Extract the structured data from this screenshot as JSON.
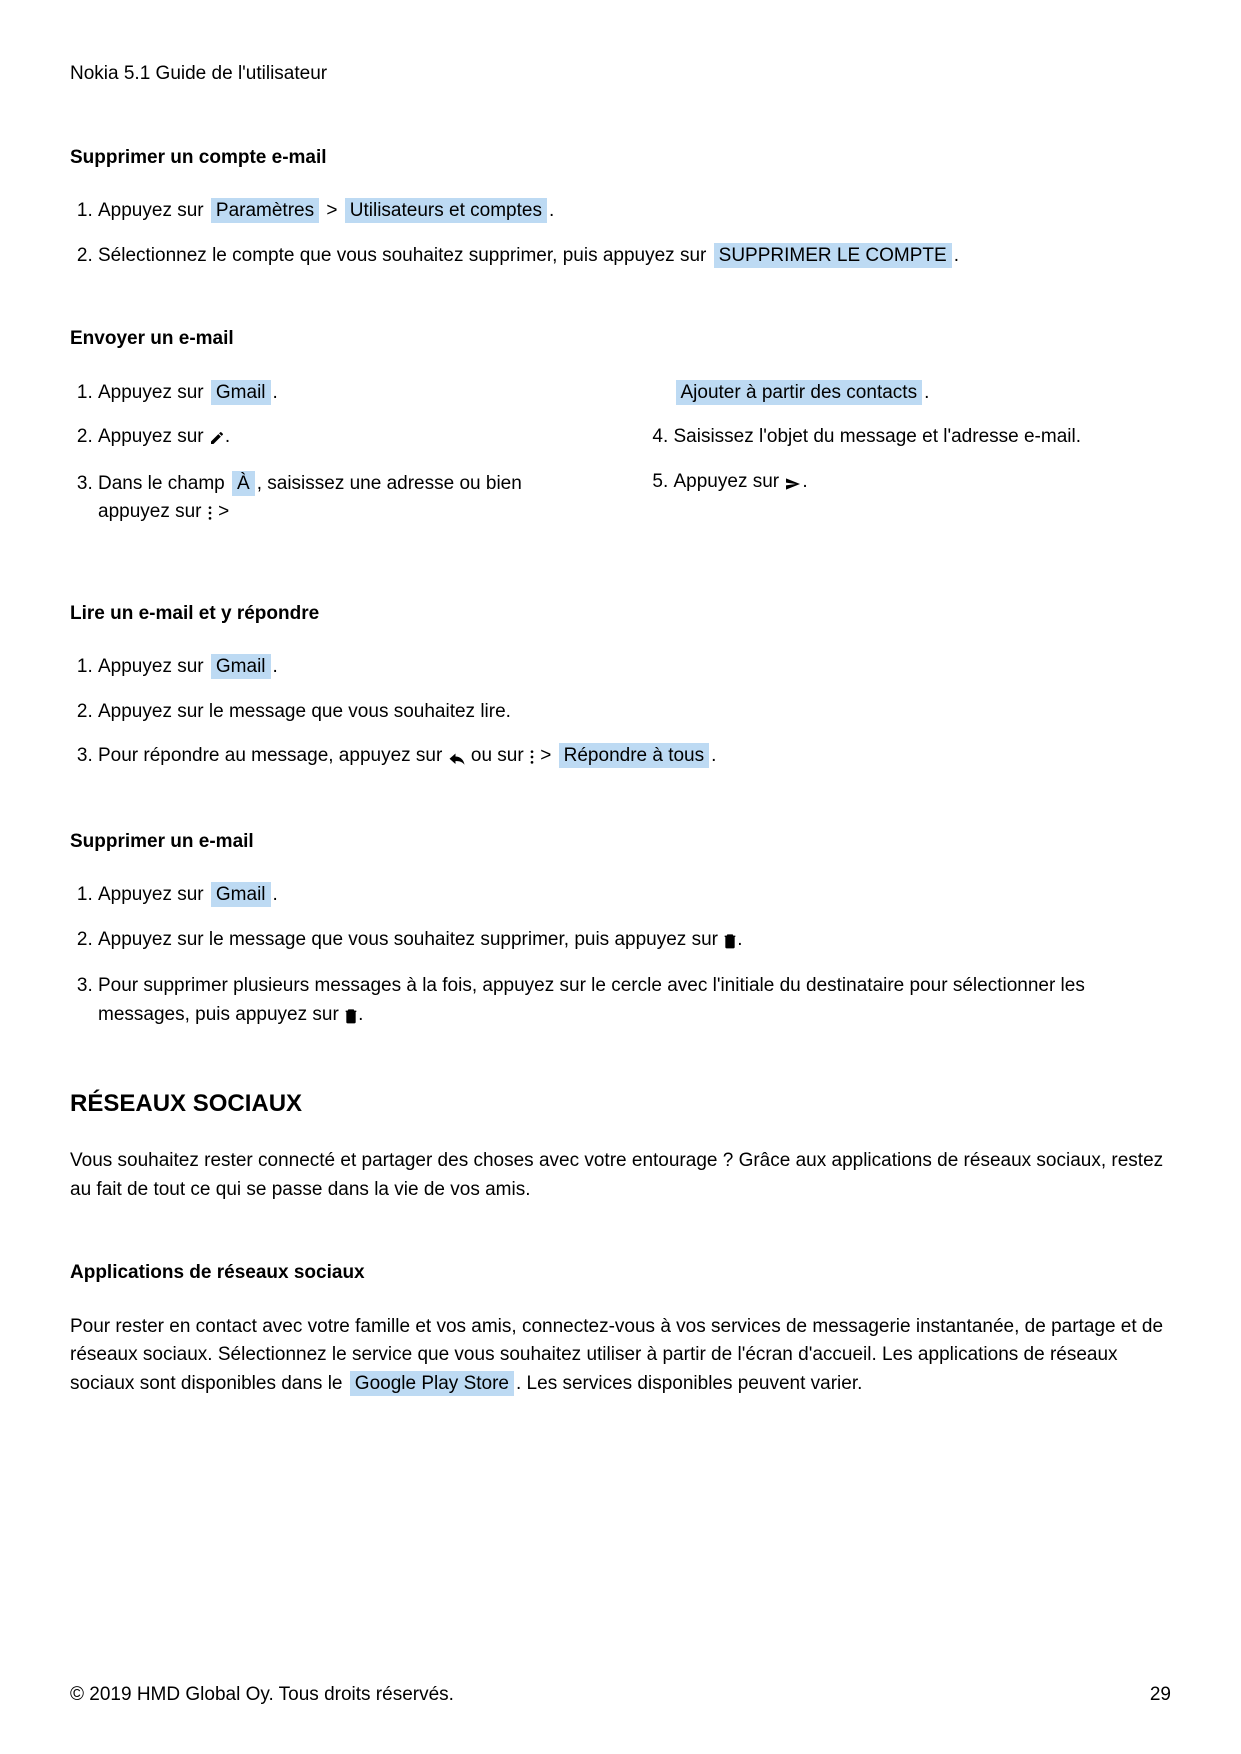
{
  "header": {
    "title": "Nokia 5.1 Guide de l'utilisateur"
  },
  "sec1": {
    "heading": "Supprimer un compte e-mail",
    "step1_pre": "Appuyez sur ",
    "step1_label1": "Paramètres",
    "step1_mid": " > ",
    "step1_label2": "Utilisateurs et comptes",
    "step1_post": ".",
    "step2_pre": "Sélectionnez le compte que vous souhaitez supprimer, puis appuyez sur ",
    "step2_label": "SUPPRIMER LE COMPTE",
    "step2_post": "."
  },
  "sec2": {
    "heading": "Envoyer un e-mail",
    "s1_pre": "Appuyez sur ",
    "s1_label": "Gmail",
    "s1_post": ".",
    "s2_pre": "Appuyez sur ",
    "s2_post": ".",
    "s3_pre": "Dans le champ ",
    "s3_label": "À",
    "s3_mid": ", saisissez une adresse ou bien appuyez sur ",
    "s3_mid2": " > ",
    "s3_cont_label": "Ajouter à partir des contacts",
    "s3_cont_post": ".",
    "s4": "Saisissez l'objet du message et l'adresse e-mail.",
    "s5_pre": "Appuyez sur ",
    "s5_post": "."
  },
  "sec3": {
    "heading": "Lire un e-mail et y répondre",
    "s1_pre": "Appuyez sur ",
    "s1_label": "Gmail",
    "s1_post": ".",
    "s2": "Appuyez sur le message que vous souhaitez lire.",
    "s3_pre": "Pour répondre au message, appuyez sur ",
    "s3_mid1": " ou sur ",
    "s3_mid2": " > ",
    "s3_label": "Répondre à tous",
    "s3_post": "."
  },
  "sec4": {
    "heading": "Supprimer un e-mail",
    "s1_pre": "Appuyez sur ",
    "s1_label": "Gmail",
    "s1_post": ".",
    "s2_pre": "Appuyez sur le message que vous souhaitez supprimer, puis appuyez sur ",
    "s2_post": ".",
    "s3_pre": "Pour supprimer plusieurs messages à la fois, appuyez sur le cercle avec l'initiale du destinataire pour sélectionner les messages, puis appuyez sur ",
    "s3_post": "."
  },
  "sec5": {
    "heading": "RÉSEAUX SOCIAUX",
    "intro": "Vous souhaitez rester connecté et partager des choses avec votre entourage ? Grâce aux applications de réseaux sociaux, restez au fait de tout ce qui se passe dans la vie de vos amis.",
    "subheading": "Applications de réseaux sociaux",
    "body_pre": "Pour rester en contact avec votre famille et vos amis, connectez-vous à vos services de messagerie instantanée, de partage et de réseaux sociaux. Sélectionnez le service que vous souhaitez utiliser à partir de l'écran d'accueil. Les applications de réseaux sociaux sont disponibles dans le ",
    "body_label": "Google Play Store",
    "body_post": ". Les services disponibles peuvent varier."
  },
  "footer": {
    "copyright": "© 2019 HMD Global Oy. Tous droits réservés.",
    "page": "29"
  }
}
